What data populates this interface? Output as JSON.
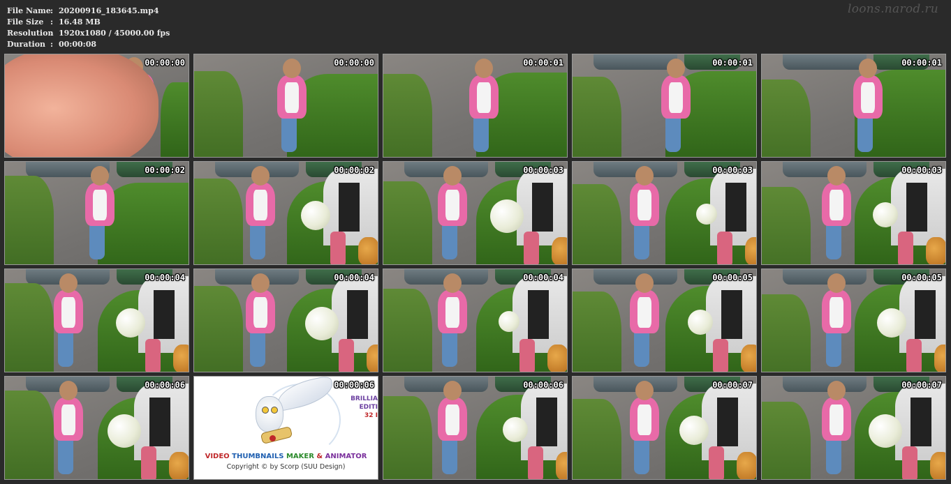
{
  "info": {
    "rows": [
      {
        "key": "File Name",
        "sep": ":",
        "value": "20200916_183645.mp4"
      },
      {
        "key": "File Size",
        "sep": ":",
        "value": "16.48 MB"
      },
      {
        "key": "Resolution",
        "sep": ":",
        "value": "1920x1080 / 45000.00 fps"
      },
      {
        "key": "Duration",
        "sep": ":",
        "value": "00:00:08"
      }
    ]
  },
  "watermark": "loons.narod.ru",
  "thumbnails": [
    {
      "time": "00:00:00",
      "scene": "finger"
    },
    {
      "time": "00:00:00",
      "scene": "girl"
    },
    {
      "time": "00:00:01",
      "scene": "girl"
    },
    {
      "time": "00:00:01",
      "scene": "girl"
    },
    {
      "time": "00:00:01",
      "scene": "girl"
    },
    {
      "time": "00:00:02",
      "scene": "girl"
    },
    {
      "time": "00:00:02",
      "scene": "balloon"
    },
    {
      "time": "00:00:03",
      "scene": "balloon"
    },
    {
      "time": "00:00:03",
      "scene": "balloon"
    },
    {
      "time": "00:00:03",
      "scene": "balloon"
    },
    {
      "time": "00:00:04",
      "scene": "balloon"
    },
    {
      "time": "00:00:04",
      "scene": "balloon"
    },
    {
      "time": "00:00:04",
      "scene": "balloon"
    },
    {
      "time": "00:00:05",
      "scene": "balloon"
    },
    {
      "time": "00:00:05",
      "scene": "balloon"
    },
    {
      "time": "00:00:06",
      "scene": "balloon"
    },
    {
      "time": "00:00:06",
      "scene": "logo"
    },
    {
      "time": "00:00:06",
      "scene": "balloon"
    },
    {
      "time": "00:00:07",
      "scene": "balloon"
    },
    {
      "time": "00:00:07",
      "scene": "balloon"
    }
  ],
  "logo": {
    "title_video": "VIDEO",
    "title_thumbnails": "THUMBNAILS",
    "title_maker": "MAKER",
    "title_amp": "&",
    "title_animator": "ANIMATOR",
    "copyright": "Copyright © by Scorp (SUU Design)",
    "side_line1": "BRILLIA",
    "side_line2": "EDITI",
    "side_line3": "32 I",
    "colors": {
      "video": "#c0282a",
      "thumbnails": "#1f5fb0",
      "maker": "#2b8a2b",
      "animator": "#7a2f9c"
    }
  }
}
